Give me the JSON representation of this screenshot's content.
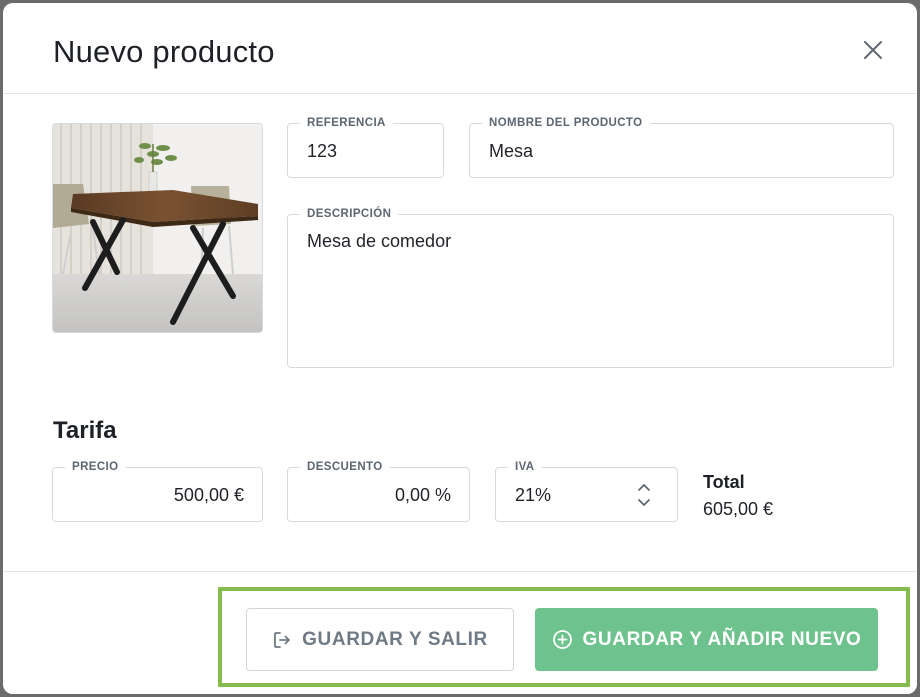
{
  "modal": {
    "title": "Nuevo producto",
    "close_icon": "close-icon"
  },
  "product": {
    "image_icon": "product-photo-table",
    "referencia": {
      "label": "REFERENCIA",
      "value": "123"
    },
    "nombre": {
      "label": "NOMBRE DEL PRODUCTO",
      "value": "Mesa"
    },
    "descripcion": {
      "label": "DESCRIPCIÓN",
      "value": "Mesa de comedor"
    }
  },
  "tarifa": {
    "title": "Tarifa",
    "precio": {
      "label": "PRECIO",
      "value": "500,00 €"
    },
    "descuento": {
      "label": "DESCUENTO",
      "value": "0,00 %"
    },
    "iva": {
      "label": "IVA",
      "value": "21%",
      "icon": "chevron-up-down-icon"
    },
    "total": {
      "label": "Total",
      "value": "605,00 €"
    }
  },
  "footer": {
    "save_exit_label": "GUARDAR Y SALIR",
    "save_exit_icon": "exit-icon",
    "save_new_label": "GUARDAR Y AÑADIR NUEVO",
    "save_new_icon": "plus-circle-icon",
    "highlight_color": "#86bb4d",
    "primary_color": "#6ec28d"
  }
}
